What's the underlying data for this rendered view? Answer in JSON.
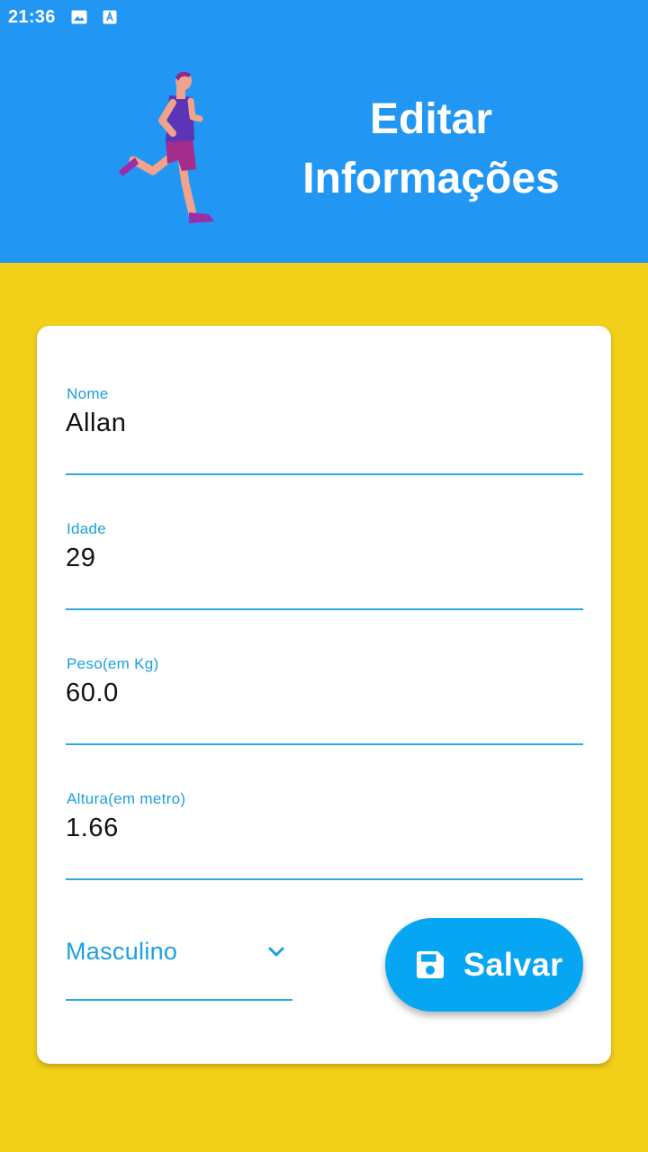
{
  "status_bar": {
    "time": "21:36",
    "icons": [
      "image-icon",
      "text-a-icon"
    ]
  },
  "header": {
    "title_line1": "Editar",
    "title_line2": "Informações",
    "background_color": "#2196f3"
  },
  "page": {
    "background_color": "#f2cf19"
  },
  "form": {
    "fields": [
      {
        "label": "Nome",
        "value": "Allan"
      },
      {
        "label": "Idade",
        "value": "29"
      },
      {
        "label": "Peso(em Kg)",
        "value": "60.0"
      },
      {
        "label": "Altura(em metro)",
        "value": "1.66"
      }
    ],
    "gender_select": {
      "value": "Masculino",
      "icon": "chevron-down-icon"
    },
    "save_button": {
      "label": "Salvar",
      "icon": "floppy-disk-icon",
      "color": "#06a6f2"
    },
    "accent_color": "#1aa0e0"
  }
}
